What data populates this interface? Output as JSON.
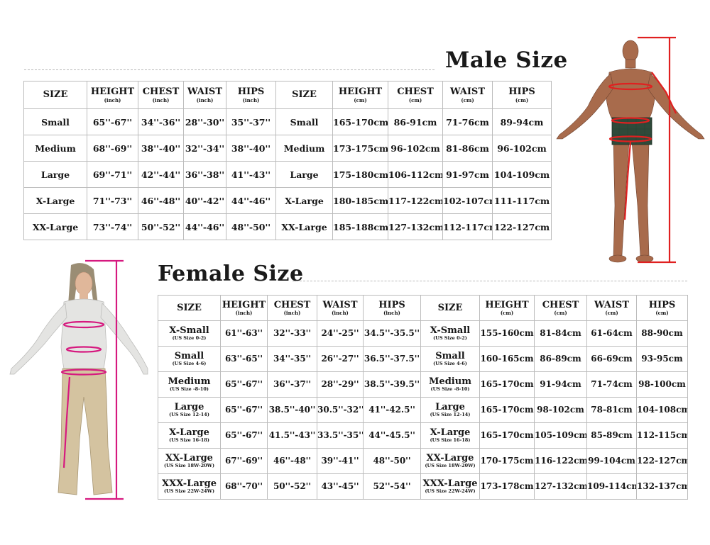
{
  "male": {
    "title": "Male Size",
    "headers": [
      {
        "label": "SIZE",
        "unit": ""
      },
      {
        "label": "HEIGHT",
        "unit": "(inch)"
      },
      {
        "label": "CHEST",
        "unit": "(inch)"
      },
      {
        "label": "WAIST",
        "unit": "(inch)"
      },
      {
        "label": "HIPS",
        "unit": "(inch)"
      },
      {
        "label": "SIZE",
        "unit": ""
      },
      {
        "label": "HEIGHT",
        "unit": "(cm)"
      },
      {
        "label": "CHEST",
        "unit": "(cm)"
      },
      {
        "label": "WAIST",
        "unit": "(cm)"
      },
      {
        "label": "HIPS",
        "unit": "(cm)"
      }
    ],
    "rows": [
      [
        "Small",
        "65''-67''",
        "34''-36''",
        "28''-30''",
        "35''-37''",
        "Small",
        "165-170cm",
        "86-91cm",
        "71-76cm",
        "89-94cm"
      ],
      [
        "Medium",
        "68''-69''",
        "38''-40''",
        "32''-34''",
        "38''-40''",
        "Medium",
        "173-175cm",
        "96-102cm",
        "81-86cm",
        "96-102cm"
      ],
      [
        "Large",
        "69''-71''",
        "42''-44''",
        "36''-38''",
        "41''-43''",
        "Large",
        "175-180cm",
        "106-112cm",
        "91-97cm",
        "104-109cm"
      ],
      [
        "X-Large",
        "71''-73''",
        "46''-48''",
        "40''-42''",
        "44''-46''",
        "X-Large",
        "180-185cm",
        "117-122cm",
        "102-107cm",
        "111-117cm"
      ],
      [
        "XX-Large",
        "73''-74''",
        "50''-52''",
        "44''-46''",
        "48''-50''",
        "XX-Large",
        "185-188cm",
        "127-132cm",
        "112-117cm",
        "122-127cm"
      ]
    ]
  },
  "female": {
    "title": "Female Size",
    "headers": [
      {
        "label": "SIZE",
        "unit": ""
      },
      {
        "label": "HEIGHT",
        "unit": "(inch)"
      },
      {
        "label": "CHEST",
        "unit": "(inch)"
      },
      {
        "label": "WAIST",
        "unit": "(inch)"
      },
      {
        "label": "HIPS",
        "unit": "(inch)"
      },
      {
        "label": "SIZE",
        "unit": ""
      },
      {
        "label": "HEIGHT",
        "unit": "(cm)"
      },
      {
        "label": "CHEST",
        "unit": "(cm)"
      },
      {
        "label": "WAIST",
        "unit": "(cm)"
      },
      {
        "label": "HIPS",
        "unit": "(cm)"
      }
    ],
    "rows": [
      [
        {
          "size": "X-Small",
          "us": "(US Size 0-2)"
        },
        "61''-63''",
        "32''-33''",
        "24''-25''",
        "34.5''-35.5''",
        {
          "size": "X-Small",
          "us": "(US Size 0-2)"
        },
        "155-160cm",
        "81-84cm",
        "61-64cm",
        "88-90cm"
      ],
      [
        {
          "size": "Small",
          "us": "(US Size 4-6)"
        },
        "63''-65''",
        "34''-35''",
        "26''-27''",
        "36.5''-37.5''",
        {
          "size": "Small",
          "us": "(US Size 4-6)"
        },
        "160-165cm",
        "86-89cm",
        "66-69cm",
        "93-95cm"
      ],
      [
        {
          "size": "Medium",
          "us": "(US Size -8-10)"
        },
        "65''-67''",
        "36''-37''",
        "28''-29''",
        "38.5''-39.5''",
        {
          "size": "Medium",
          "us": "(US Size -8-10)"
        },
        "165-170cm",
        "91-94cm",
        "71-74cm",
        "98-100cm"
      ],
      [
        {
          "size": "Large",
          "us": "(US Size 12-14)"
        },
        "65''-67''",
        "38.5''-40''",
        "30.5''-32''",
        "41''-42.5''",
        {
          "size": "Large",
          "us": "(US Size 12-14)"
        },
        "165-170cm",
        "98-102cm",
        "78-81cm",
        "104-108cm"
      ],
      [
        {
          "size": "X-Large",
          "us": "(US Size 16-18)"
        },
        "65''-67''",
        "41.5''-43''",
        "33.5''-35''",
        "44''-45.5''",
        {
          "size": "X-Large",
          "us": "(US Size 16-18)"
        },
        "165-170cm",
        "105-109cm",
        "85-89cm",
        "112-115cm"
      ],
      [
        {
          "size": "XX-Large",
          "us": "(US Size 18W-20W)"
        },
        "67''-69''",
        "46''-48''",
        "39''-41''",
        "48''-50''",
        {
          "size": "XX-Large",
          "us": "(US Size 18W-20W)"
        },
        "170-175cm",
        "116-122cm",
        "99-104cm",
        "122-127cm"
      ],
      [
        {
          "size": "XXX-Large",
          "us": "(US Size 22W-24W)"
        },
        "68''-70''",
        "50''-52''",
        "43''-45''",
        "52''-54''",
        {
          "size": "XXX-Large",
          "us": "(US Size 22W-24W)"
        },
        "173-178cm",
        "127-132cm",
        "109-114cm",
        "132-137cm"
      ]
    ]
  },
  "colors": {
    "male_measure_lines": "#e02020",
    "female_measure_lines": "#d6197f",
    "male_skin": "#a86b4c",
    "male_shorts": "#2f4a3a",
    "female_top": "#e4e4e2",
    "female_pants": "#d4c3a0",
    "female_hair": "#9a8d74"
  },
  "icons": {
    "male": "male-body-model",
    "female": "female-body-model"
  }
}
